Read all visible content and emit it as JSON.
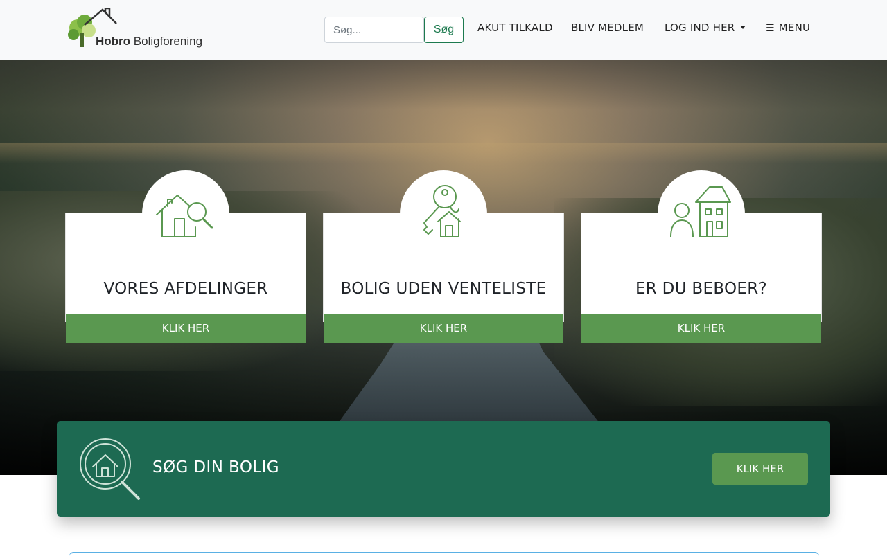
{
  "header": {
    "logo": {
      "name_bold": "Hobro",
      "name_rest": "Boligforening"
    },
    "search": {
      "placeholder": "Søg...",
      "button_label": "Søg"
    },
    "nav": {
      "akut": "AKUT TILKALD",
      "bliv": "BLIV MEDLEM",
      "log_ind": "LOG IND HER",
      "menu": "MENU",
      "menu_icon": "☰"
    }
  },
  "cards": [
    {
      "title": "VORES AFDELINGER",
      "button": "KLIK HER",
      "icon": "house-search-icon"
    },
    {
      "title": "BOLIG UDEN VENTELISTE",
      "button": "KLIK HER",
      "icon": "key-house-icon"
    },
    {
      "title": "ER DU BEBOER?",
      "button": "KLIK HER",
      "icon": "resident-house-icon"
    }
  ],
  "banner": {
    "title": "SØG DIN BOLIG",
    "button": "KLIK HER",
    "icon": "magnifier-house-icon"
  },
  "colors": {
    "brand_green": "#5a9850",
    "dark_green": "#1d6a52",
    "search_button_green": "#1d7a4f"
  }
}
